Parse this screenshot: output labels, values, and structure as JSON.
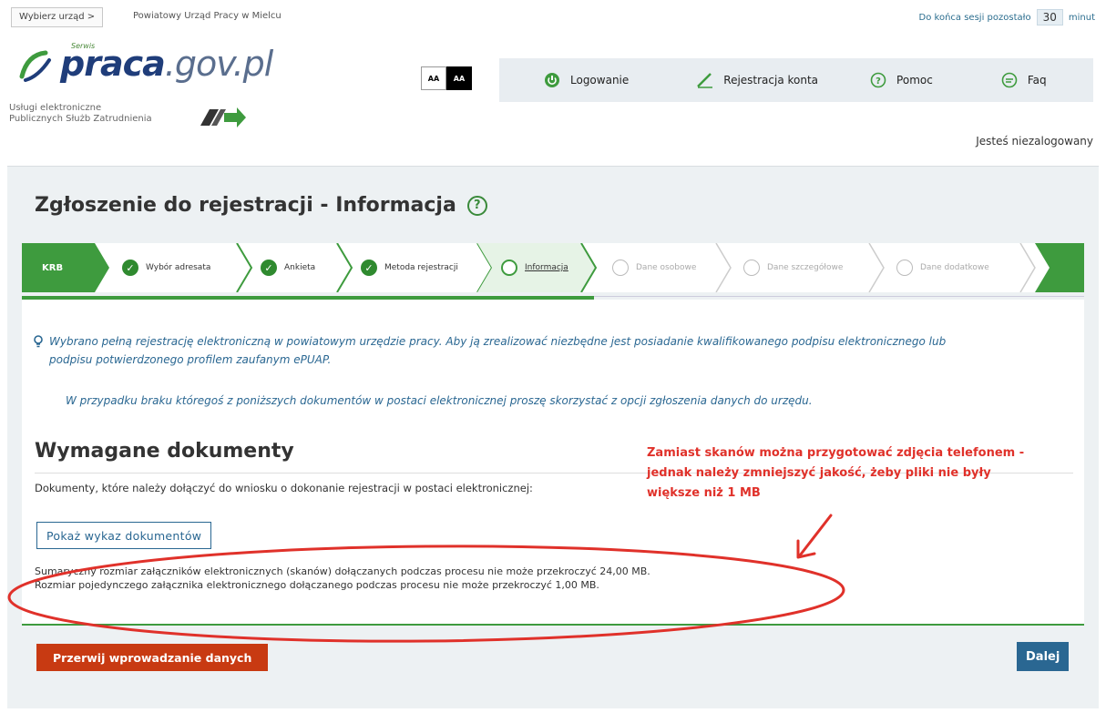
{
  "topbar": {
    "office_select_label": "Wybierz urząd  >",
    "office_name": "Powiatowy Urząd Pracy w Mielcu",
    "session_prefix": "Do końca sesji pozostało",
    "session_minutes": "30",
    "session_suffix": "minut"
  },
  "logo": {
    "small": "Serwis",
    "brand": "praca",
    "tld": ".gov.pl",
    "services_line1": "Usługi elektroniczne",
    "services_line2": "Publicznych Służb Zatrudnienia"
  },
  "contrast": {
    "normal": "AA",
    "high": "AA"
  },
  "menu": {
    "login": "Logowanie",
    "register": "Rejestracja konta",
    "help": "Pomoc",
    "faq": "Faq"
  },
  "user_status": "Jesteś niezalogowany",
  "page": {
    "title": "Zgłoszenie do rejestracji - Informacja"
  },
  "steps": {
    "start": "KRB",
    "items": [
      {
        "label": "Wybór adresata"
      },
      {
        "label": "Ankieta"
      },
      {
        "label": "Metoda rejestracji"
      },
      {
        "label": "Informacja"
      },
      {
        "label": "Dane osobowe"
      },
      {
        "label": "Dane szczegółowe"
      },
      {
        "label": "Dane dodatkowe"
      }
    ]
  },
  "info": {
    "line1": "Wybrano pełną rejestrację elektroniczną w powiatowym urzędzie pracy. Aby ją zrealizować niezbędne jest posiadanie kwalifikowanego podpisu elektronicznego lub podpisu potwierdzonego profilem zaufanym ePUAP.",
    "line2": "W przypadku braku któregoś z poniższych dokumentów w postaci elektronicznej proszę skorzystać z opcji zgłoszenia danych do urzędu."
  },
  "documents": {
    "title": "Wymagane dokumenty",
    "description": "Dokumenty, które należy dołączyć do wniosku o dokonanie rejestracji w postaci elektronicznej:",
    "show_button": "Pokaż wykaz dokumentów",
    "size_total": "Sumaryczny rozmiar załączników elektronicznych (skanów) dołączanych podczas procesu nie może przekroczyć 24,00 MB.",
    "size_single": "Rozmiar pojedynczego załącznika elektronicznego dołączanego podczas procesu nie może przekroczyć 1,00 MB."
  },
  "annotation": {
    "line1": "Zamiast skanów można przygotować zdjęcia telefonem -",
    "line2": "jednak należy zmniejszyć jakość, żeby pliki nie były",
    "line3": "większe niż 1 MB"
  },
  "buttons": {
    "cancel": "Przerwij wprowadzanie danych",
    "next": "Dalej"
  },
  "colors": {
    "green": "#3e9b3e",
    "blue": "#2a6792",
    "red_button": "#c83a12",
    "annotation_red": "#e0312a"
  }
}
